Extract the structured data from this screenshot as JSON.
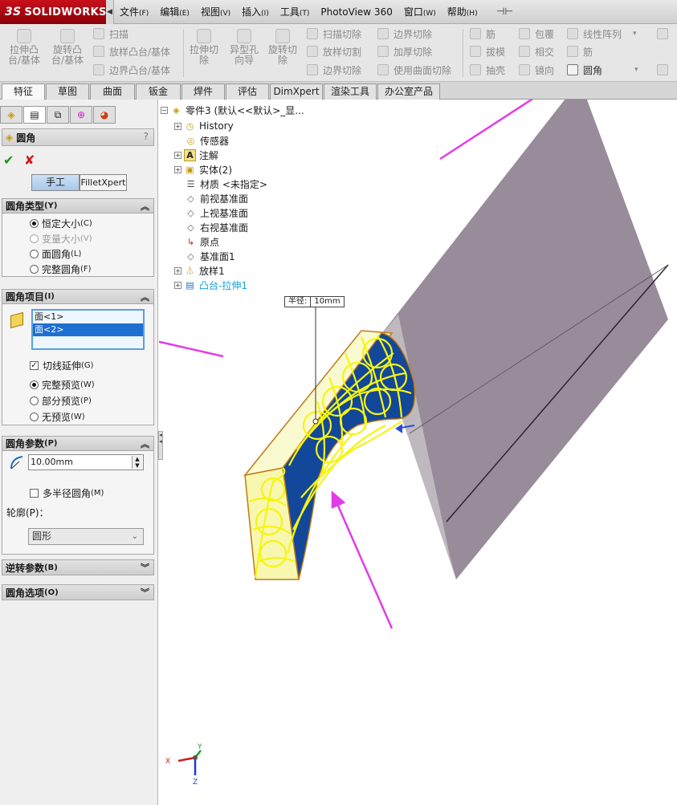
{
  "app": {
    "logo_text": "SOLIDWORKS",
    "logo_mark": "3S"
  },
  "menubar": [
    {
      "label": "文件",
      "key": "(F)"
    },
    {
      "label": "编辑",
      "key": "(E)"
    },
    {
      "label": "视图",
      "key": "(V)"
    },
    {
      "label": "插入",
      "key": "(I)"
    },
    {
      "label": "工具",
      "key": "(T)"
    },
    {
      "label": "PhotoView 360",
      "key": ""
    },
    {
      "label": "窗口",
      "key": "(W)"
    },
    {
      "label": "帮助",
      "key": "(H)"
    }
  ],
  "toolbar": {
    "extrude_boss": "拉伸凸\n台/基体",
    "revolve_boss": "旋转凸\n台/基体",
    "sweep": "扫描",
    "loft_boss": "放样凸台/基体",
    "boundary_boss": "边界凸台/基体",
    "extrude_cut": "拉伸切\n除",
    "hole_wizard": "异型孔\n向导",
    "revolve_cut": "旋转切\n除",
    "swept_cut": "扫描切除",
    "lofted_cut": "放样切割",
    "boundary_cut": "边界切除",
    "boundary_cut2": "边界切除",
    "thicken_cut": "加厚切除",
    "surface_cut": "使用曲面切除",
    "rib": "筋",
    "draft": "拔模",
    "shell": "抽壳",
    "wrap": "包覆",
    "intersect": "相交",
    "mirror": "镜向",
    "linear_pattern": "线性阵列",
    "rib2": "筋",
    "fillet": "圆角"
  },
  "tabs": [
    "特征",
    "草图",
    "曲面",
    "钣金",
    "焊件",
    "评估",
    "DimXpert",
    "渲染工具",
    "办公室产品"
  ],
  "panel": {
    "title": "圆角",
    "help": "?",
    "ok": "✔",
    "cancel": "✘",
    "mode_manual": "手工",
    "mode_filletxpert": "FilletXpert",
    "fillet_type": {
      "header": "圆角类型",
      "header_key": "(Y)",
      "options": [
        {
          "label": "恒定大小",
          "key": "(C)"
        },
        {
          "label": "变量大小",
          "key": "(V)"
        },
        {
          "label": "面圆角",
          "key": "(L)"
        },
        {
          "label": "完整圆角",
          "key": "(F)"
        }
      ]
    },
    "items": {
      "header": "圆角项目",
      "header_key": "(I)",
      "faces": [
        "面<1>",
        "面<2>"
      ],
      "tangent": {
        "label": "切线延伸",
        "key": "(G)"
      },
      "previews": [
        {
          "label": "完整预览",
          "key": "(W)"
        },
        {
          "label": "部分预览",
          "key": "(P)"
        },
        {
          "label": "无预览",
          "key": "(W)"
        }
      ]
    },
    "params": {
      "header": "圆角参数",
      "header_key": "(P)",
      "radius": "10.00mm",
      "multi_radius": {
        "label": "多半径圆角",
        "key": "(M)"
      },
      "profile_label": "轮廓(P)：",
      "profile_value": "圆形"
    },
    "reverse": {
      "header": "逆转参数",
      "header_key": "(B)"
    },
    "options": {
      "header": "圆角选项",
      "header_key": "(O)"
    }
  },
  "tree": [
    {
      "label": "零件3  (默认<<默认>_显...",
      "expandable": false
    },
    {
      "label": "History",
      "expandable": true
    },
    {
      "label": "传感器",
      "expandable": false
    },
    {
      "label": "注解",
      "expandable": true
    },
    {
      "label": "实体(2)",
      "expandable": true
    },
    {
      "label": "材质 <未指定>",
      "expandable": false
    },
    {
      "label": "前视基准面",
      "expandable": false
    },
    {
      "label": "上视基准面",
      "expandable": false
    },
    {
      "label": "右视基准面",
      "expandable": false
    },
    {
      "label": "原点",
      "expandable": false
    },
    {
      "label": "基准面1",
      "expandable": false
    },
    {
      "label": "放样1",
      "expandable": true
    },
    {
      "label": "凸台-拉伸1",
      "expandable": true
    }
  ],
  "dimension": {
    "name": "半径:",
    "value": "10mm"
  },
  "triad": {
    "x": "X",
    "y": "Y",
    "z": "Z"
  },
  "colors": {
    "blade": "#988b9a",
    "handle_face": "#12479a",
    "highlight": "#f5f512",
    "arrow": "#e23ce8"
  }
}
